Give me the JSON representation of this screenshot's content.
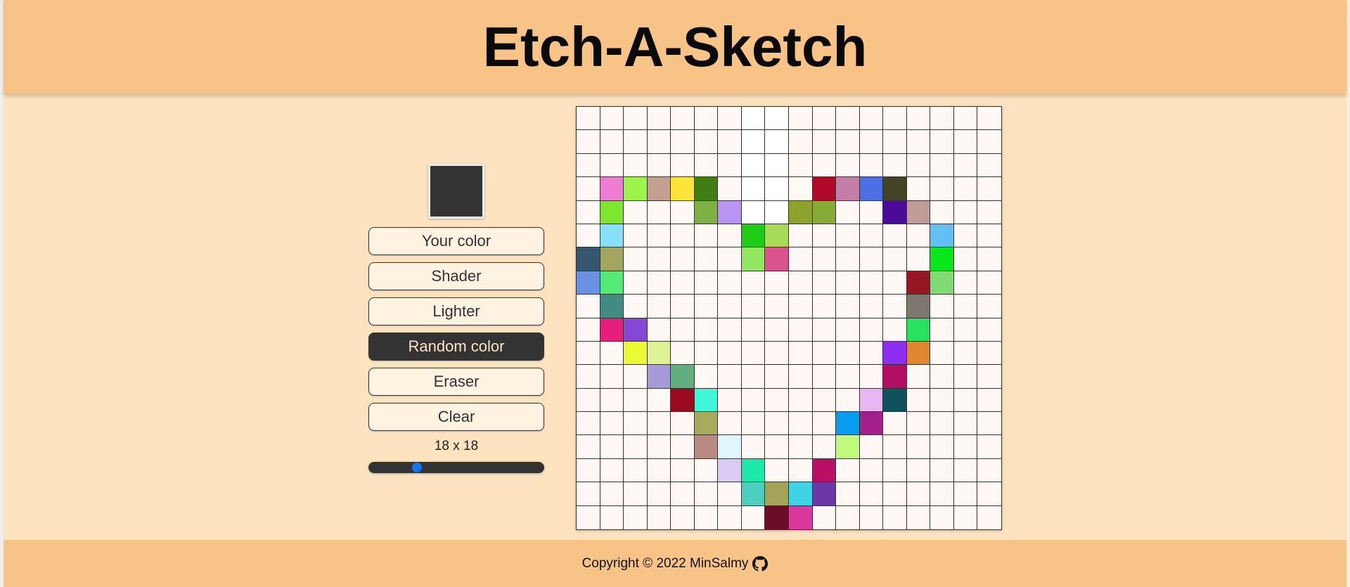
{
  "header": {
    "title": "Etch-A-Sketch"
  },
  "controls": {
    "current_color": "#333333",
    "buttons": [
      {
        "label": "Your color",
        "active": false
      },
      {
        "label": "Shader",
        "active": false
      },
      {
        "label": "Lighter",
        "active": false
      },
      {
        "label": "Random color",
        "active": true
      },
      {
        "label": "Eraser",
        "active": false
      },
      {
        "label": "Clear",
        "active": false
      }
    ],
    "size_label": "18 x 18",
    "slider": {
      "value": 18,
      "min": 2,
      "max": 64
    }
  },
  "grid": {
    "rows": 18,
    "cols": 18,
    "background": "#fff8f4",
    "highlight_cells": [
      [
        0,
        7
      ],
      [
        0,
        8
      ],
      [
        1,
        7
      ],
      [
        1,
        8
      ],
      [
        2,
        7
      ],
      [
        2,
        8
      ],
      [
        3,
        7
      ],
      [
        3,
        8
      ],
      [
        4,
        7
      ],
      [
        4,
        8
      ],
      [
        5,
        8
      ]
    ],
    "highlight_color": "#ffffff",
    "painted_cells": [
      {
        "row": 3,
        "col": 1,
        "color": "#ee7ed2"
      },
      {
        "row": 3,
        "col": 2,
        "color": "#9cf44a"
      },
      {
        "row": 3,
        "col": 3,
        "color": "#c4a093"
      },
      {
        "row": 3,
        "col": 4,
        "color": "#fbe53a"
      },
      {
        "row": 3,
        "col": 5,
        "color": "#3e7e12"
      },
      {
        "row": 3,
        "col": 10,
        "color": "#b1092a"
      },
      {
        "row": 3,
        "col": 11,
        "color": "#c57ea8"
      },
      {
        "row": 3,
        "col": 12,
        "color": "#4c6fe3"
      },
      {
        "row": 3,
        "col": 13,
        "color": "#434326"
      },
      {
        "row": 4,
        "col": 1,
        "color": "#7ee631"
      },
      {
        "row": 4,
        "col": 5,
        "color": "#81b046"
      },
      {
        "row": 4,
        "col": 6,
        "color": "#b894f5"
      },
      {
        "row": 4,
        "col": 9,
        "color": "#8ea32b"
      },
      {
        "row": 4,
        "col": 10,
        "color": "#86ab36"
      },
      {
        "row": 4,
        "col": 13,
        "color": "#4c0a9b"
      },
      {
        "row": 4,
        "col": 14,
        "color": "#bf9c97"
      },
      {
        "row": 5,
        "col": 1,
        "color": "#87e0f7"
      },
      {
        "row": 5,
        "col": 7,
        "color": "#1fcd17"
      },
      {
        "row": 5,
        "col": 8,
        "color": "#a7da59"
      },
      {
        "row": 5,
        "col": 15,
        "color": "#63c0f2"
      },
      {
        "row": 6,
        "col": 0,
        "color": "#375670"
      },
      {
        "row": 6,
        "col": 1,
        "color": "#a4a561"
      },
      {
        "row": 6,
        "col": 7,
        "color": "#93e662"
      },
      {
        "row": 6,
        "col": 8,
        "color": "#d9538e"
      },
      {
        "row": 6,
        "col": 15,
        "color": "#0be61a"
      },
      {
        "row": 7,
        "col": 0,
        "color": "#6b91e3"
      },
      {
        "row": 7,
        "col": 1,
        "color": "#55e978"
      },
      {
        "row": 7,
        "col": 14,
        "color": "#961621"
      },
      {
        "row": 7,
        "col": 15,
        "color": "#82db72"
      },
      {
        "row": 8,
        "col": 1,
        "color": "#418b84"
      },
      {
        "row": 8,
        "col": 14,
        "color": "#7f776e"
      },
      {
        "row": 9,
        "col": 1,
        "color": "#e71f7c"
      },
      {
        "row": 9,
        "col": 2,
        "color": "#8547d6"
      },
      {
        "row": 9,
        "col": 14,
        "color": "#27e15f"
      },
      {
        "row": 10,
        "col": 2,
        "color": "#e9fa34"
      },
      {
        "row": 10,
        "col": 3,
        "color": "#dff295"
      },
      {
        "row": 10,
        "col": 13,
        "color": "#8d2ff2"
      },
      {
        "row": 10,
        "col": 14,
        "color": "#e08732"
      },
      {
        "row": 11,
        "col": 3,
        "color": "#a69ad8"
      },
      {
        "row": 11,
        "col": 4,
        "color": "#62ae7f"
      },
      {
        "row": 11,
        "col": 13,
        "color": "#b30f62"
      },
      {
        "row": 12,
        "col": 4,
        "color": "#9a0b20"
      },
      {
        "row": 12,
        "col": 5,
        "color": "#40f6d8"
      },
      {
        "row": 12,
        "col": 12,
        "color": "#eab5f3"
      },
      {
        "row": 12,
        "col": 13,
        "color": "#10525a"
      },
      {
        "row": 13,
        "col": 5,
        "color": "#a8aa5d"
      },
      {
        "row": 13,
        "col": 11,
        "color": "#069cf0"
      },
      {
        "row": 13,
        "col": 12,
        "color": "#a4218b"
      },
      {
        "row": 14,
        "col": 5,
        "color": "#b98a7f"
      },
      {
        "row": 14,
        "col": 6,
        "color": "#dff6fb"
      },
      {
        "row": 14,
        "col": 11,
        "color": "#c1fb7d"
      },
      {
        "row": 15,
        "col": 6,
        "color": "#d9cbf4"
      },
      {
        "row": 15,
        "col": 7,
        "color": "#1ceaaa"
      },
      {
        "row": 15,
        "col": 10,
        "color": "#b80e64"
      },
      {
        "row": 16,
        "col": 7,
        "color": "#4ccfbf"
      },
      {
        "row": 16,
        "col": 8,
        "color": "#a3a35a"
      },
      {
        "row": 16,
        "col": 9,
        "color": "#40d3e7"
      },
      {
        "row": 16,
        "col": 10,
        "color": "#6c38a8"
      },
      {
        "row": 17,
        "col": 8,
        "color": "#6b0d28"
      },
      {
        "row": 17,
        "col": 9,
        "color": "#d9399e"
      }
    ]
  },
  "footer": {
    "text": "Copyright © 2022 MinSalmy",
    "icon": "github-icon"
  }
}
